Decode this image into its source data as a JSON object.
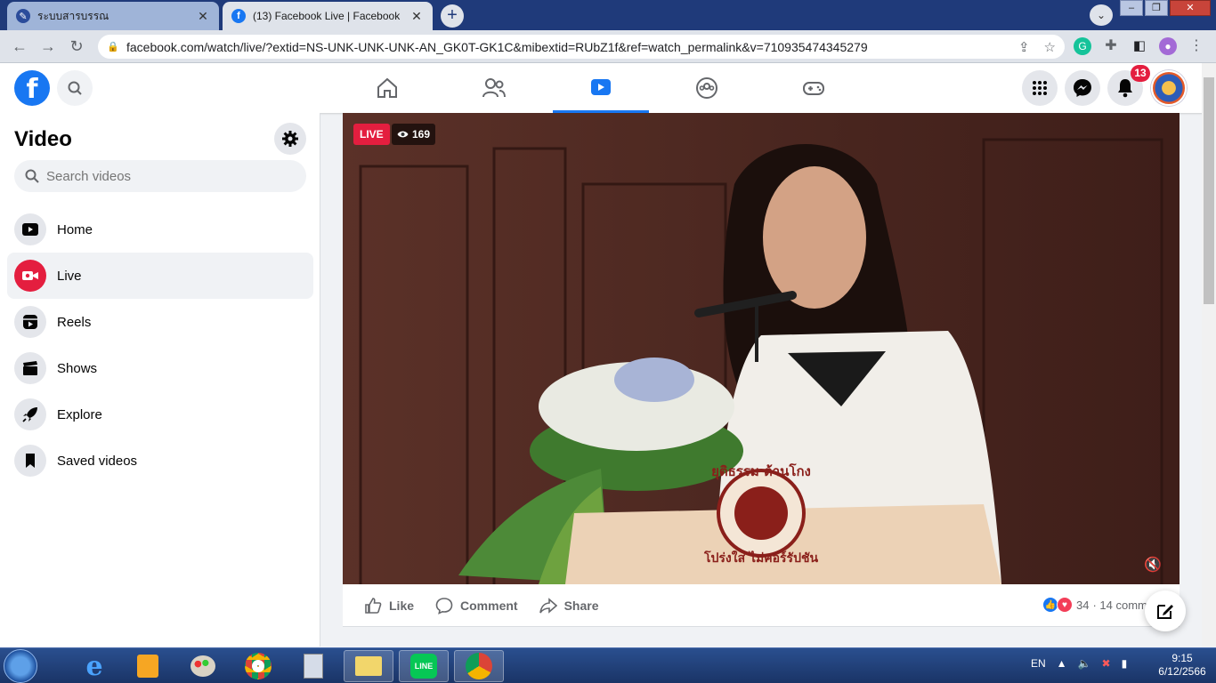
{
  "browser": {
    "tabs": [
      {
        "title": "ระบบสารบรรณ",
        "active": false
      },
      {
        "title": "(13) Facebook Live | Facebook",
        "active": true
      }
    ],
    "url": "facebook.com/watch/live/?extid=NS-UNK-UNK-UNK-AN_GK0T-GK1C&mibextid=RUbZ1f&ref=watch_permalink&v=710935474345279"
  },
  "fb": {
    "notifications_count": "13",
    "accent": "#1877f2"
  },
  "sidebar": {
    "title": "Video",
    "search_placeholder": "Search videos",
    "items": [
      {
        "label": "Home",
        "icon": "play-screen-icon"
      },
      {
        "label": "Live",
        "icon": "live-camera-icon",
        "active": true
      },
      {
        "label": "Reels",
        "icon": "reels-icon"
      },
      {
        "label": "Shows",
        "icon": "clapperboard-icon"
      },
      {
        "label": "Explore",
        "icon": "rocket-icon"
      },
      {
        "label": "Saved videos",
        "icon": "bookmark-icon"
      }
    ]
  },
  "video": {
    "live_label": "LIVE",
    "viewers": "169",
    "podium_logo_text_top": "ยุติธรรม ต้านโกง",
    "podium_logo_text_bottom": "โปร่งใส ไม่คอร์รัปชัน"
  },
  "actions": {
    "like": "Like",
    "comment": "Comment",
    "share": "Share",
    "reaction_count": "34",
    "comments_count": "· 14 comm"
  },
  "taskbar": {
    "lang": "EN",
    "time": "9:15",
    "date": "6/12/2566"
  }
}
